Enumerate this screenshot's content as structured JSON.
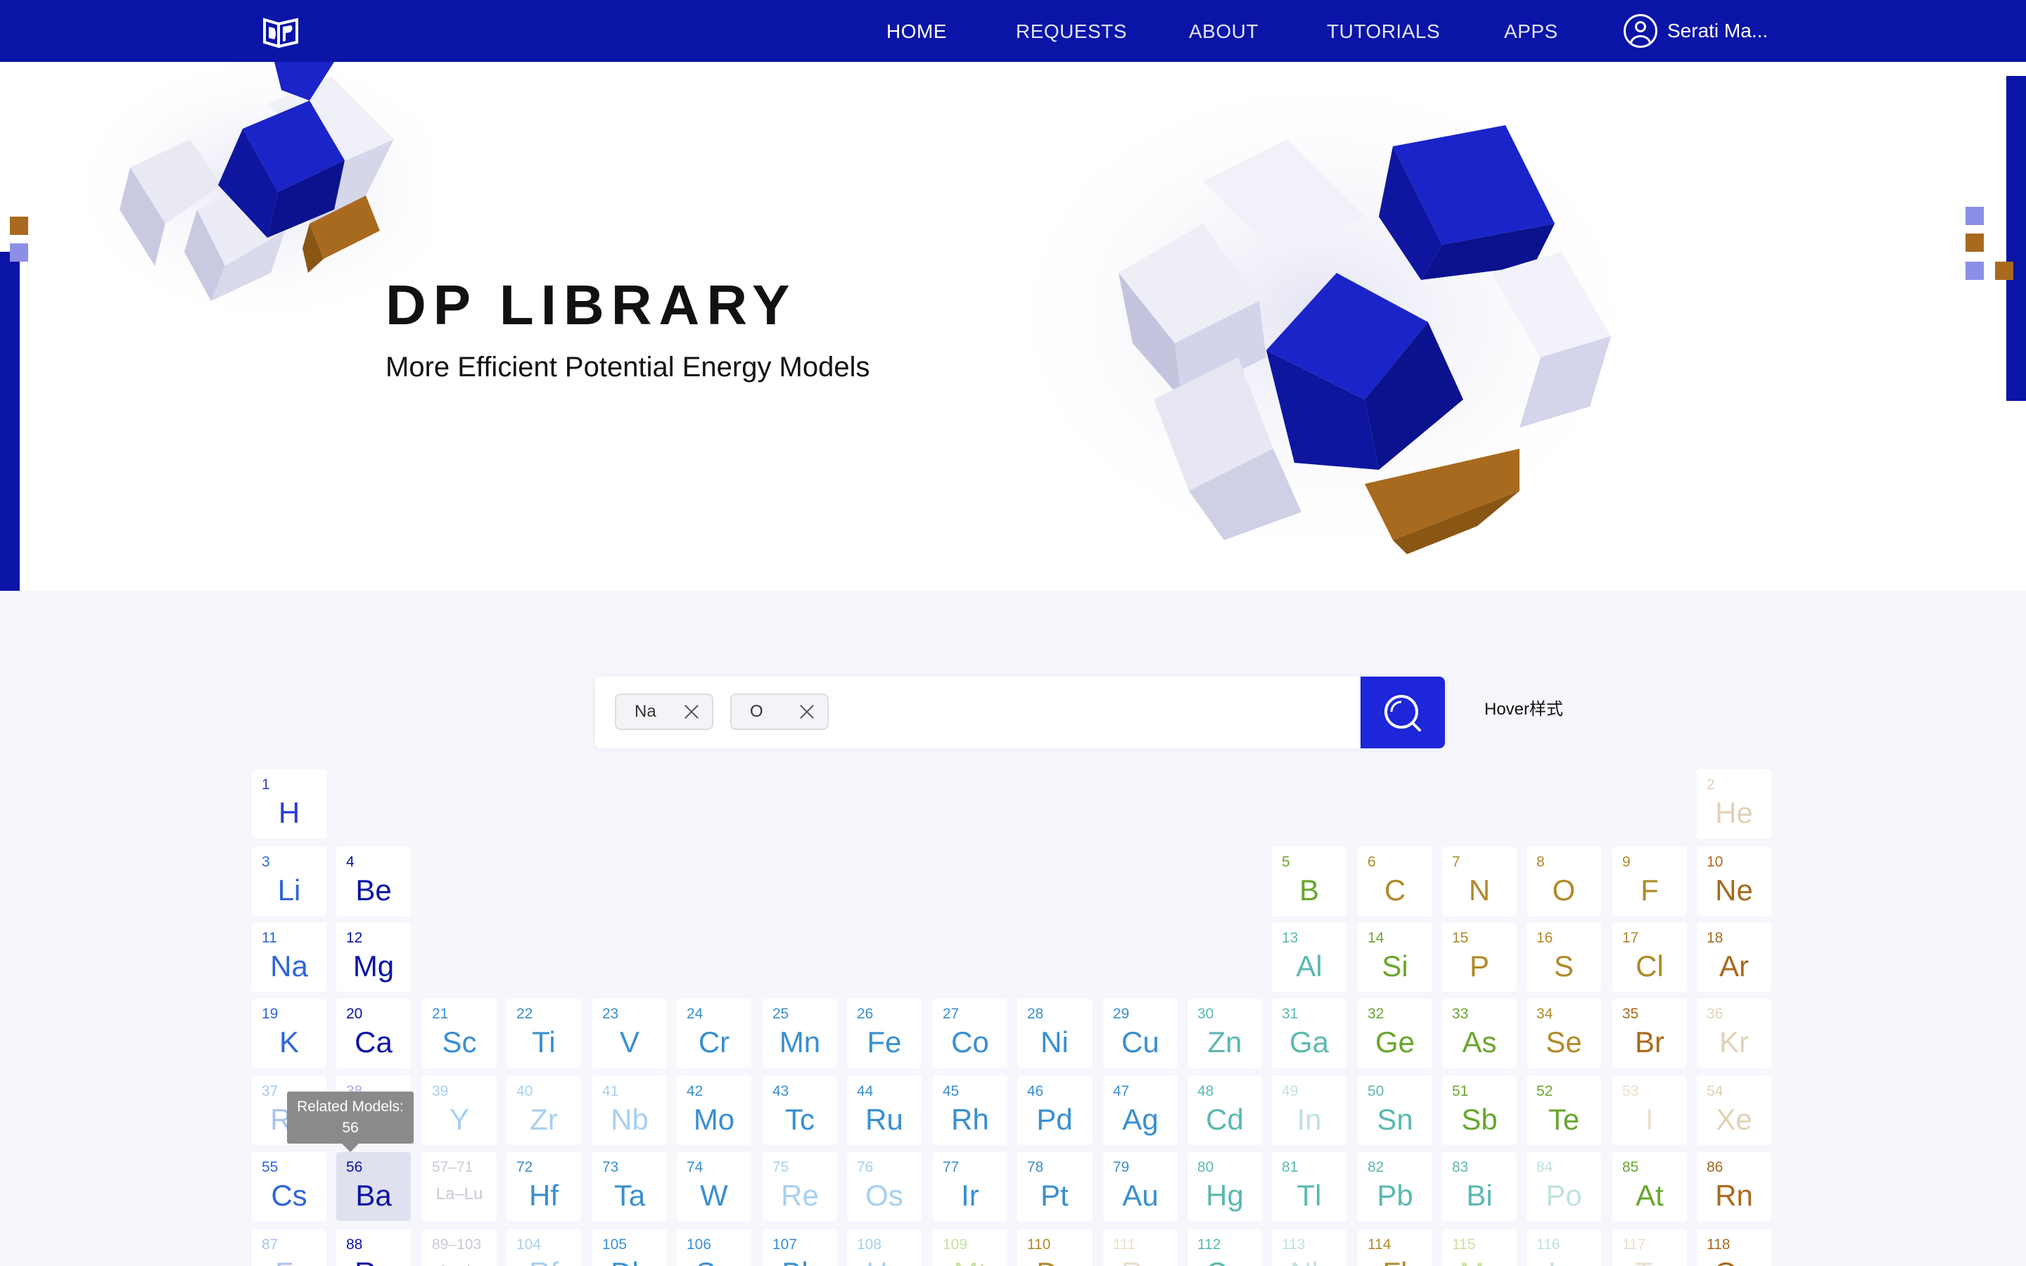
{
  "nav": {
    "items": [
      {
        "label": "HOME",
        "active": true
      },
      {
        "label": "REQUESTS",
        "active": false
      },
      {
        "label": "ABOUT",
        "active": false
      },
      {
        "label": "TUTORIALS",
        "active": false
      },
      {
        "label": "APPS",
        "active": false
      }
    ],
    "user_name": "Serati Ma..."
  },
  "hero": {
    "title": "DP LIBRARY",
    "subtitle": "More Efficient Potential Energy Models"
  },
  "search": {
    "chips": [
      "Na",
      "O"
    ],
    "button_icon": "search-icon"
  },
  "hover_note": "Hover样式",
  "tooltip": {
    "line1": "Related Models:",
    "line2": "56"
  },
  "colors": {
    "brand_blue": "#0a14a6",
    "button_blue": "#1d26d8",
    "accent_orange": "#a86a1e",
    "accent_lavender": "#8d8fe6"
  },
  "periodic_table": {
    "elements": [
      {
        "n": "1",
        "s": "H",
        "c": "#2b3bd8"
      },
      {
        "n": "2",
        "s": "He",
        "c": "#e2d2b7"
      },
      {
        "n": "3",
        "s": "Li",
        "c": "#2f66d8"
      },
      {
        "n": "4",
        "s": "Be",
        "c": "#0a14a6"
      },
      {
        "n": "5",
        "s": "B",
        "c": "#6aa62e"
      },
      {
        "n": "6",
        "s": "C",
        "c": "#b08a2a"
      },
      {
        "n": "7",
        "s": "N",
        "c": "#b08a2a"
      },
      {
        "n": "8",
        "s": "O",
        "c": "#b08a2a"
      },
      {
        "n": "9",
        "s": "F",
        "c": "#b08a2a"
      },
      {
        "n": "10",
        "s": "Ne",
        "c": "#a86a1e"
      },
      {
        "n": "11",
        "s": "Na",
        "c": "#2f66d8"
      },
      {
        "n": "12",
        "s": "Mg",
        "c": "#0a14a6"
      },
      {
        "n": "13",
        "s": "Al",
        "c": "#5cb8b0"
      },
      {
        "n": "14",
        "s": "Si",
        "c": "#6aa62e"
      },
      {
        "n": "15",
        "s": "P",
        "c": "#b08a2a"
      },
      {
        "n": "16",
        "s": "S",
        "c": "#b08a2a"
      },
      {
        "n": "17",
        "s": "Cl",
        "c": "#b08a2a"
      },
      {
        "n": "18",
        "s": "Ar",
        "c": "#a86a1e"
      },
      {
        "n": "19",
        "s": "K",
        "c": "#2f66d8"
      },
      {
        "n": "20",
        "s": "Ca",
        "c": "#0a14a6"
      },
      {
        "n": "21",
        "s": "Sc",
        "c": "#3a8fcf"
      },
      {
        "n": "22",
        "s": "Ti",
        "c": "#3a8fcf"
      },
      {
        "n": "23",
        "s": "V",
        "c": "#3a8fcf"
      },
      {
        "n": "24",
        "s": "Cr",
        "c": "#3a8fcf"
      },
      {
        "n": "25",
        "s": "Mn",
        "c": "#3a8fcf"
      },
      {
        "n": "26",
        "s": "Fe",
        "c": "#3a8fcf"
      },
      {
        "n": "27",
        "s": "Co",
        "c": "#3a8fcf"
      },
      {
        "n": "28",
        "s": "Ni",
        "c": "#3a8fcf"
      },
      {
        "n": "29",
        "s": "Cu",
        "c": "#3a8fcf"
      },
      {
        "n": "30",
        "s": "Zn",
        "c": "#5cb8b0"
      },
      {
        "n": "31",
        "s": "Ga",
        "c": "#5cb8b0"
      },
      {
        "n": "32",
        "s": "Ge",
        "c": "#6aa62e"
      },
      {
        "n": "33",
        "s": "As",
        "c": "#6aa62e"
      },
      {
        "n": "34",
        "s": "Se",
        "c": "#b08a2a"
      },
      {
        "n": "35",
        "s": "Br",
        "c": "#a86a1e"
      },
      {
        "n": "36",
        "s": "Kr",
        "c": "#e2d2b7"
      },
      {
        "n": "37",
        "s": "Rb",
        "c": "#a9c4ee"
      },
      {
        "n": "38",
        "s": "Sr",
        "c": "#a9b0e0"
      },
      {
        "n": "39",
        "s": "Y",
        "c": "#a9d0ee"
      },
      {
        "n": "40",
        "s": "Zr",
        "c": "#a9d0ee"
      },
      {
        "n": "41",
        "s": "Nb",
        "c": "#a9d0ee"
      },
      {
        "n": "42",
        "s": "Mo",
        "c": "#3a8fcf"
      },
      {
        "n": "43",
        "s": "Tc",
        "c": "#3a8fcf"
      },
      {
        "n": "44",
        "s": "Ru",
        "c": "#3a8fcf"
      },
      {
        "n": "45",
        "s": "Rh",
        "c": "#3a8fcf"
      },
      {
        "n": "46",
        "s": "Pd",
        "c": "#3a8fcf"
      },
      {
        "n": "47",
        "s": "Ag",
        "c": "#3a8fcf"
      },
      {
        "n": "48",
        "s": "Cd",
        "c": "#5cb8b0"
      },
      {
        "n": "49",
        "s": "In",
        "c": "#bfe3df"
      },
      {
        "n": "50",
        "s": "Sn",
        "c": "#5cb8b0"
      },
      {
        "n": "51",
        "s": "Sb",
        "c": "#6aa62e"
      },
      {
        "n": "52",
        "s": "Te",
        "c": "#6aa62e"
      },
      {
        "n": "53",
        "s": "I",
        "c": "#eadfcb"
      },
      {
        "n": "54",
        "s": "Xe",
        "c": "#e2d2b7"
      },
      {
        "n": "55",
        "s": "Cs",
        "c": "#2f66d8"
      },
      {
        "n": "56",
        "s": "Ba",
        "c": "#0a14a6"
      },
      {
        "n": "57–71",
        "s": "La–Lu",
        "c": "#c9c9d4"
      },
      {
        "n": "72",
        "s": "Hf",
        "c": "#3a8fcf"
      },
      {
        "n": "73",
        "s": "Ta",
        "c": "#3a8fcf"
      },
      {
        "n": "74",
        "s": "W",
        "c": "#3a8fcf"
      },
      {
        "n": "75",
        "s": "Re",
        "c": "#a9d0ee"
      },
      {
        "n": "76",
        "s": "Os",
        "c": "#a9d0ee"
      },
      {
        "n": "77",
        "s": "Ir",
        "c": "#3a8fcf"
      },
      {
        "n": "78",
        "s": "Pt",
        "c": "#3a8fcf"
      },
      {
        "n": "79",
        "s": "Au",
        "c": "#3a8fcf"
      },
      {
        "n": "80",
        "s": "Hg",
        "c": "#5cb8b0"
      },
      {
        "n": "81",
        "s": "Tl",
        "c": "#5cb8b0"
      },
      {
        "n": "82",
        "s": "Pb",
        "c": "#5cb8b0"
      },
      {
        "n": "83",
        "s": "Bi",
        "c": "#5cb8b0"
      },
      {
        "n": "84",
        "s": "Po",
        "c": "#bfe3df"
      },
      {
        "n": "85",
        "s": "At",
        "c": "#6aa62e"
      },
      {
        "n": "86",
        "s": "Rn",
        "c": "#a86a1e"
      },
      {
        "n": "87",
        "s": "Fr",
        "c": "#a9c4ee"
      },
      {
        "n": "88",
        "s": "Ra",
        "c": "#0a14a6"
      },
      {
        "n": "89–103",
        "s": "Ac–Lr",
        "c": "#c9c9d4"
      },
      {
        "n": "104",
        "s": "Rf",
        "c": "#a9d0ee"
      },
      {
        "n": "105",
        "s": "Db",
        "c": "#3a8fcf"
      },
      {
        "n": "106",
        "s": "Sg",
        "c": "#3a8fcf"
      },
      {
        "n": "107",
        "s": "Bh",
        "c": "#3a8fcf"
      },
      {
        "n": "108",
        "s": "Hs",
        "c": "#a9d0ee"
      },
      {
        "n": "109",
        "s": "Mt",
        "c": "#c8e2a0"
      },
      {
        "n": "110",
        "s": "Ds",
        "c": "#b08a2a"
      },
      {
        "n": "111",
        "s": "Rg",
        "c": "#eadfcb"
      },
      {
        "n": "112",
        "s": "Cn",
        "c": "#5cb8b0"
      },
      {
        "n": "113",
        "s": "Nh",
        "c": "#bfe3df"
      },
      {
        "n": "114",
        "s": "Fl",
        "c": "#b08a2a"
      },
      {
        "n": "115",
        "s": "Mc",
        "c": "#c8e2a0"
      },
      {
        "n": "116",
        "s": "Lv",
        "c": "#bfe3df"
      },
      {
        "n": "117",
        "s": "Ts",
        "c": "#eadfcb"
      },
      {
        "n": "118",
        "s": "Og",
        "c": "#a86a1e"
      }
    ]
  }
}
